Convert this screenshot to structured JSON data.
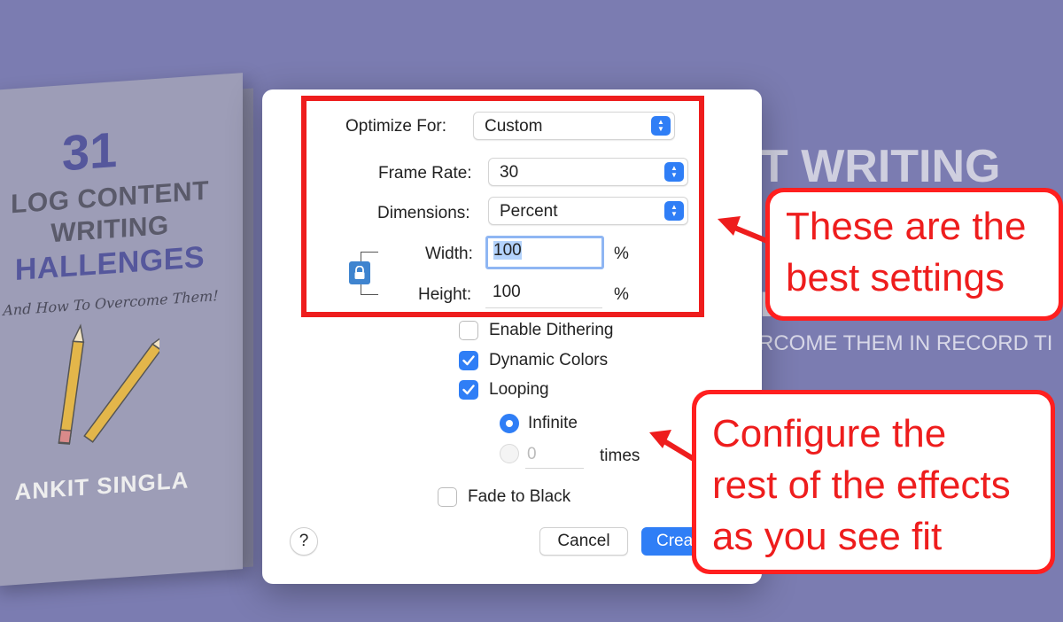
{
  "background": {
    "book": {
      "number": "31",
      "title_line1": "LOG CONTENT",
      "title_line2": "WRITING",
      "title_line3": "HALLENGES",
      "subtitle": "And How To Overcome Them!",
      "author": "ANKIT SINGLA"
    },
    "heading": "T WRITING",
    "heading_fragment": "E",
    "tagline": "ERCOME THEM IN RECORD TI"
  },
  "dialog": {
    "optimize_for": {
      "label": "Optimize For:",
      "value": "Custom"
    },
    "frame_rate": {
      "label": "Frame Rate:",
      "value": "30"
    },
    "dimensions": {
      "label": "Dimensions:",
      "value": "Percent"
    },
    "width": {
      "label": "Width:",
      "value": "100",
      "unit": "%"
    },
    "height": {
      "label": "Height:",
      "value": "100",
      "unit": "%"
    },
    "options": {
      "enable_dithering": {
        "label": "Enable Dithering",
        "checked": false
      },
      "dynamic_colors": {
        "label": "Dynamic Colors",
        "checked": true
      },
      "looping": {
        "label": "Looping",
        "checked": true
      },
      "infinite": {
        "label": "Infinite",
        "selected": true
      },
      "times": {
        "value": "0",
        "label": "times",
        "selected": false
      },
      "fade_to_black": {
        "label": "Fade to Black",
        "checked": false
      }
    },
    "help_label": "?",
    "cancel_label": "Cancel",
    "create_label": "Crea"
  },
  "annotations": {
    "callout1": {
      "line1": "These are the",
      "line2": "best settings"
    },
    "callout2": {
      "line1": "Configure the",
      "line2": "rest of the effects",
      "line3": "as you see fit"
    }
  },
  "colors": {
    "backdrop": "#7b7cb1",
    "accent": "#2f7ef6",
    "annotation": "#ee1d1d"
  }
}
